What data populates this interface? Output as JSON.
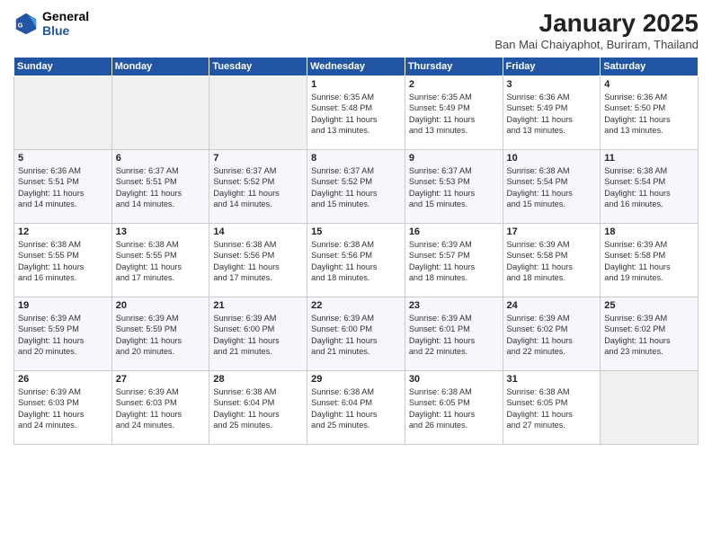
{
  "logo": {
    "line1": "General",
    "line2": "Blue"
  },
  "title": "January 2025",
  "subtitle": "Ban Mai Chaiyaphot, Buriram, Thailand",
  "weekdays": [
    "Sunday",
    "Monday",
    "Tuesday",
    "Wednesday",
    "Thursday",
    "Friday",
    "Saturday"
  ],
  "weeks": [
    [
      {
        "day": "",
        "info": ""
      },
      {
        "day": "",
        "info": ""
      },
      {
        "day": "",
        "info": ""
      },
      {
        "day": "1",
        "info": "Sunrise: 6:35 AM\nSunset: 5:48 PM\nDaylight: 11 hours\nand 13 minutes."
      },
      {
        "day": "2",
        "info": "Sunrise: 6:35 AM\nSunset: 5:49 PM\nDaylight: 11 hours\nand 13 minutes."
      },
      {
        "day": "3",
        "info": "Sunrise: 6:36 AM\nSunset: 5:49 PM\nDaylight: 11 hours\nand 13 minutes."
      },
      {
        "day": "4",
        "info": "Sunrise: 6:36 AM\nSunset: 5:50 PM\nDaylight: 11 hours\nand 13 minutes."
      }
    ],
    [
      {
        "day": "5",
        "info": "Sunrise: 6:36 AM\nSunset: 5:51 PM\nDaylight: 11 hours\nand 14 minutes."
      },
      {
        "day": "6",
        "info": "Sunrise: 6:37 AM\nSunset: 5:51 PM\nDaylight: 11 hours\nand 14 minutes."
      },
      {
        "day": "7",
        "info": "Sunrise: 6:37 AM\nSunset: 5:52 PM\nDaylight: 11 hours\nand 14 minutes."
      },
      {
        "day": "8",
        "info": "Sunrise: 6:37 AM\nSunset: 5:52 PM\nDaylight: 11 hours\nand 15 minutes."
      },
      {
        "day": "9",
        "info": "Sunrise: 6:37 AM\nSunset: 5:53 PM\nDaylight: 11 hours\nand 15 minutes."
      },
      {
        "day": "10",
        "info": "Sunrise: 6:38 AM\nSunset: 5:54 PM\nDaylight: 11 hours\nand 15 minutes."
      },
      {
        "day": "11",
        "info": "Sunrise: 6:38 AM\nSunset: 5:54 PM\nDaylight: 11 hours\nand 16 minutes."
      }
    ],
    [
      {
        "day": "12",
        "info": "Sunrise: 6:38 AM\nSunset: 5:55 PM\nDaylight: 11 hours\nand 16 minutes."
      },
      {
        "day": "13",
        "info": "Sunrise: 6:38 AM\nSunset: 5:55 PM\nDaylight: 11 hours\nand 17 minutes."
      },
      {
        "day": "14",
        "info": "Sunrise: 6:38 AM\nSunset: 5:56 PM\nDaylight: 11 hours\nand 17 minutes."
      },
      {
        "day": "15",
        "info": "Sunrise: 6:38 AM\nSunset: 5:56 PM\nDaylight: 11 hours\nand 18 minutes."
      },
      {
        "day": "16",
        "info": "Sunrise: 6:39 AM\nSunset: 5:57 PM\nDaylight: 11 hours\nand 18 minutes."
      },
      {
        "day": "17",
        "info": "Sunrise: 6:39 AM\nSunset: 5:58 PM\nDaylight: 11 hours\nand 18 minutes."
      },
      {
        "day": "18",
        "info": "Sunrise: 6:39 AM\nSunset: 5:58 PM\nDaylight: 11 hours\nand 19 minutes."
      }
    ],
    [
      {
        "day": "19",
        "info": "Sunrise: 6:39 AM\nSunset: 5:59 PM\nDaylight: 11 hours\nand 20 minutes."
      },
      {
        "day": "20",
        "info": "Sunrise: 6:39 AM\nSunset: 5:59 PM\nDaylight: 11 hours\nand 20 minutes."
      },
      {
        "day": "21",
        "info": "Sunrise: 6:39 AM\nSunset: 6:00 PM\nDaylight: 11 hours\nand 21 minutes."
      },
      {
        "day": "22",
        "info": "Sunrise: 6:39 AM\nSunset: 6:00 PM\nDaylight: 11 hours\nand 21 minutes."
      },
      {
        "day": "23",
        "info": "Sunrise: 6:39 AM\nSunset: 6:01 PM\nDaylight: 11 hours\nand 22 minutes."
      },
      {
        "day": "24",
        "info": "Sunrise: 6:39 AM\nSunset: 6:02 PM\nDaylight: 11 hours\nand 22 minutes."
      },
      {
        "day": "25",
        "info": "Sunrise: 6:39 AM\nSunset: 6:02 PM\nDaylight: 11 hours\nand 23 minutes."
      }
    ],
    [
      {
        "day": "26",
        "info": "Sunrise: 6:39 AM\nSunset: 6:03 PM\nDaylight: 11 hours\nand 24 minutes."
      },
      {
        "day": "27",
        "info": "Sunrise: 6:39 AM\nSunset: 6:03 PM\nDaylight: 11 hours\nand 24 minutes."
      },
      {
        "day": "28",
        "info": "Sunrise: 6:38 AM\nSunset: 6:04 PM\nDaylight: 11 hours\nand 25 minutes."
      },
      {
        "day": "29",
        "info": "Sunrise: 6:38 AM\nSunset: 6:04 PM\nDaylight: 11 hours\nand 25 minutes."
      },
      {
        "day": "30",
        "info": "Sunrise: 6:38 AM\nSunset: 6:05 PM\nDaylight: 11 hours\nand 26 minutes."
      },
      {
        "day": "31",
        "info": "Sunrise: 6:38 AM\nSunset: 6:05 PM\nDaylight: 11 hours\nand 27 minutes."
      },
      {
        "day": "",
        "info": ""
      }
    ]
  ]
}
